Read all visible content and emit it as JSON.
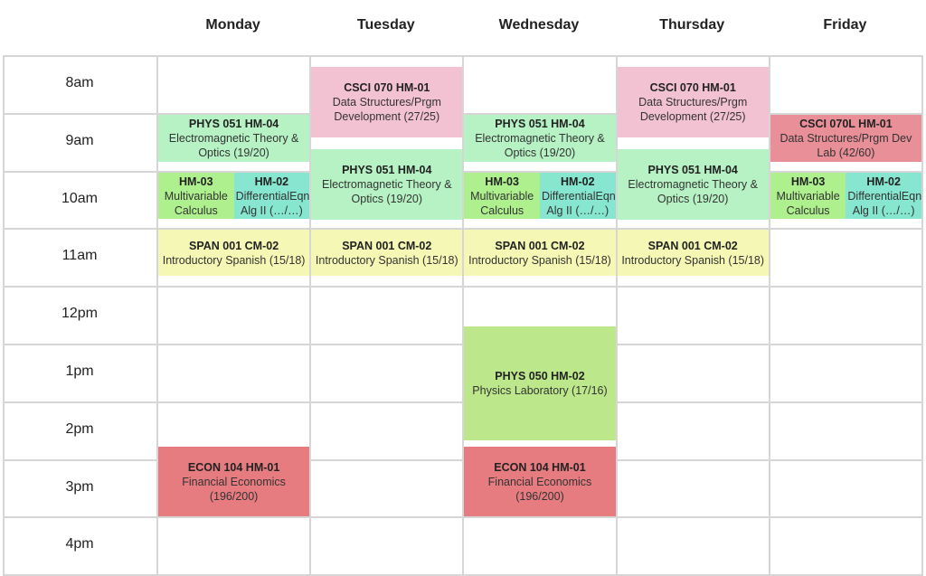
{
  "days": [
    "Monday",
    "Tuesday",
    "Wednesday",
    "Thursday",
    "Friday"
  ],
  "times": [
    "8am",
    "9am",
    "10am",
    "11am",
    "12pm",
    "1pm",
    "2pm",
    "3pm",
    "4pm"
  ],
  "colors": {
    "pink": "#f3c2d2",
    "light_green": "#b6f2c4",
    "bright_green": "#aef08e",
    "teal": "#86e6cf",
    "red_light": "#e88f98",
    "red": "#e67b80",
    "yellow": "#f5f7b4",
    "lab_green": "#bce88b"
  },
  "events": [
    {
      "day": 1,
      "start": 8.17,
      "end": 9.42,
      "code": "CSCI 070 HM-01",
      "title": "Data Structures/Prgm Development (27/25)",
      "color": "pink"
    },
    {
      "day": 3,
      "start": 8.17,
      "end": 9.42,
      "code": "CSCI 070 HM-01",
      "title": "Data Structures/Prgm Development (27/25)",
      "color": "pink"
    },
    {
      "day": 0,
      "start": 9.0,
      "end": 9.85,
      "code": "PHYS 051 HM-04",
      "title": "Electromagnetic Theory & Optics (19/20)",
      "color": "light_green"
    },
    {
      "day": 2,
      "start": 9.0,
      "end": 9.85,
      "code": "PHYS 051 HM-04",
      "title": "Electromagnetic Theory & Optics (19/20)",
      "color": "light_green"
    },
    {
      "day": 1,
      "start": 9.6,
      "end": 10.85,
      "code": "PHYS 051 HM-04",
      "title": "Electromagnetic Theory & Optics (19/20)",
      "color": "light_green"
    },
    {
      "day": 3,
      "start": 9.6,
      "end": 10.85,
      "code": "PHYS 051 HM-04",
      "title": "Electromagnetic Theory & Optics (19/20)",
      "color": "light_green"
    },
    {
      "day": 4,
      "start": 9.0,
      "end": 9.85,
      "code": "CSCI 070L HM-01",
      "title": "Data Structures/Prgm Dev Lab (42/60)",
      "color": "red_light"
    },
    {
      "day": 0,
      "start": 10.0,
      "end": 10.83,
      "code": "HM-03",
      "title": "Multivariable Calculus (…/…)",
      "color": "bright_green",
      "half": 0
    },
    {
      "day": 0,
      "start": 10.0,
      "end": 10.83,
      "code": "HM-02",
      "title": "DifferentialEqn Alg II (…/…)",
      "color": "teal",
      "half": 1
    },
    {
      "day": 2,
      "start": 10.0,
      "end": 10.83,
      "code": "HM-03",
      "title": "Multivariable Calculus (…/…)",
      "color": "bright_green",
      "half": 0
    },
    {
      "day": 2,
      "start": 10.0,
      "end": 10.83,
      "code": "HM-02",
      "title": "DifferentialEqn Alg II (…/…)",
      "color": "teal",
      "half": 1
    },
    {
      "day": 4,
      "start": 10.0,
      "end": 10.83,
      "code": "HM-03",
      "title": "Multivariable Calculus (…/…)",
      "color": "bright_green",
      "half": 0
    },
    {
      "day": 4,
      "start": 10.0,
      "end": 10.83,
      "code": "HM-02",
      "title": "DifferentialEqn Alg II (…/…)",
      "color": "teal",
      "half": 1
    },
    {
      "day": 0,
      "start": 11.0,
      "end": 11.83,
      "code": "SPAN 001 CM-02",
      "title": "Introductory Spanish (15/18)",
      "color": "yellow"
    },
    {
      "day": 1,
      "start": 11.0,
      "end": 11.83,
      "code": "SPAN 001 CM-02",
      "title": "Introductory Spanish (15/18)",
      "color": "yellow"
    },
    {
      "day": 2,
      "start": 11.0,
      "end": 11.83,
      "code": "SPAN 001 CM-02",
      "title": "Introductory Spanish (15/18)",
      "color": "yellow"
    },
    {
      "day": 3,
      "start": 11.0,
      "end": 11.83,
      "code": "SPAN 001 CM-02",
      "title": "Introductory Spanish (15/18)",
      "color": "yellow"
    },
    {
      "day": 2,
      "start": 12.67,
      "end": 14.67,
      "code": "PHYS 050 HM-02",
      "title": "Physics Laboratory (17/16)",
      "color": "lab_green"
    },
    {
      "day": 0,
      "start": 14.75,
      "end": 16.0,
      "code": "ECON 104 HM-01",
      "title": "Financial Economics (196/200)",
      "color": "red"
    },
    {
      "day": 2,
      "start": 14.75,
      "end": 16.0,
      "code": "ECON 104 HM-01",
      "title": "Financial Economics (196/200)",
      "color": "red"
    }
  ]
}
